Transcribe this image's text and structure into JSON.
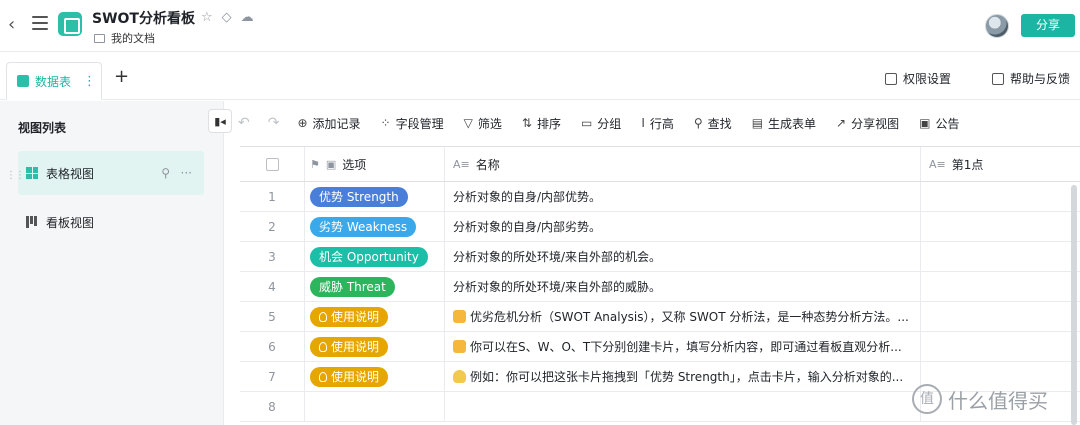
{
  "topbar": {
    "back_icon": "chevron-left-icon",
    "title": "SWOT分析看板",
    "folder": "我的文档",
    "share_label": "分享"
  },
  "tabs": [
    {
      "label": "数据表"
    }
  ],
  "tab_more": "⋮",
  "tab_add": "+",
  "tab_actions": {
    "permissions": "权限设置",
    "help": "帮助与反馈"
  },
  "sidebar": {
    "title": "视图列表",
    "items": [
      {
        "label": "表格视图",
        "icon": "grid-icon"
      },
      {
        "label": "看板视图",
        "icon": "kanban-icon"
      }
    ]
  },
  "toolbar": {
    "add_record": "添加记录",
    "field_manage": "字段管理",
    "filter": "筛选",
    "sort": "排序",
    "group": "分组",
    "row_height": "行高",
    "find": "查找",
    "generate_form": "生成表单",
    "share_view": "分享视图",
    "notice": "公告"
  },
  "columns": {
    "option": "选项",
    "name": "名称",
    "point1": "第1点"
  },
  "rows": [
    {
      "num": "1",
      "tag": "优势 Strength",
      "tag_color": "#4a7fd9",
      "tag_icon": "",
      "name": "分析对象的自身/内部优势。",
      "name_icon": ""
    },
    {
      "num": "2",
      "tag": "劣势 Weakness",
      "tag_color": "#3aa9ec",
      "tag_icon": "",
      "name": "分析对象的自身/内部劣势。",
      "name_icon": ""
    },
    {
      "num": "3",
      "tag": "机会 Opportunity",
      "tag_color": "#1bbfa8",
      "tag_icon": "",
      "name": "分析对象的所处环境/来自外部的机会。",
      "name_icon": ""
    },
    {
      "num": "4",
      "tag": "威胁 Threat",
      "tag_color": "#2db55d",
      "tag_icon": "",
      "name": "分析对象的所处环境/来自外部的威胁。",
      "name_icon": ""
    },
    {
      "num": "5",
      "tag": "使用说明",
      "tag_color": "#e6a600",
      "tag_icon": "bulb",
      "name": "优劣危机分析（SWOT Analysis），又称 SWOT 分析法，是一种态势分析方法。...",
      "name_icon": "thumb"
    },
    {
      "num": "6",
      "tag": "使用说明",
      "tag_color": "#e6a600",
      "tag_icon": "bulb",
      "name": "你可以在S、W、O、T下分别创建卡片，填写分析内容，即可通过看板直观分析...",
      "name_icon": "thumb"
    },
    {
      "num": "7",
      "tag": "使用说明",
      "tag_color": "#e6a600",
      "tag_icon": "bulb",
      "name": "例如：你可以把这张卡片拖拽到「优势 Strength」，点击卡片，输入分析对象的...",
      "name_icon": "bulb"
    },
    {
      "num": "8",
      "tag": "",
      "tag_color": "",
      "tag_icon": "",
      "name": "",
      "name_icon": ""
    }
  ],
  "watermark": "什么值得买"
}
